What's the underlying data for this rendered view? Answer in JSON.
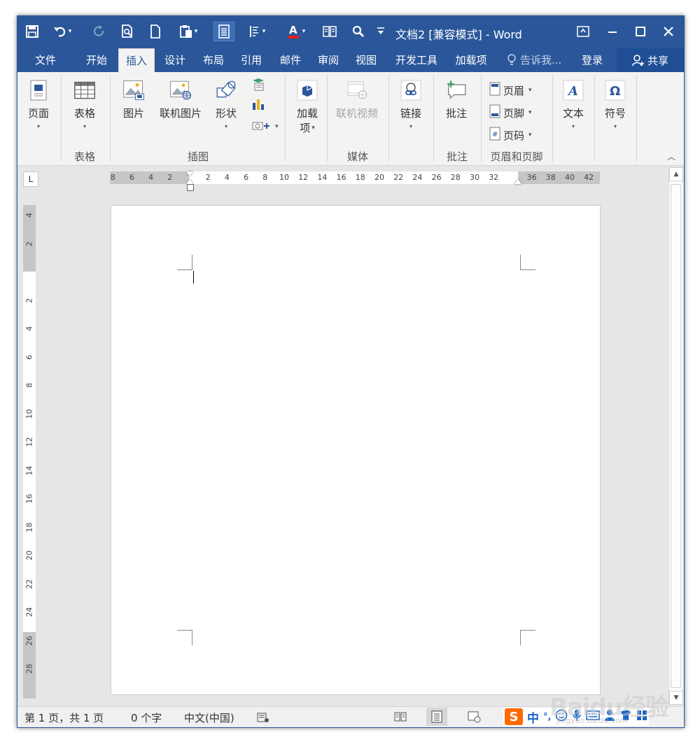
{
  "titlebar": {
    "title": "文档2 [兼容模式] - Word",
    "qat": [
      "save-icon",
      "undo-icon",
      "redo-icon",
      "print-preview-icon",
      "new-document-icon",
      "paste-icon",
      "layout-icon",
      "paragraph-icon",
      "font-color-icon",
      "columns-icon",
      "find-icon",
      "customize-icon"
    ],
    "controls": [
      "ribbon-display-icon",
      "minimize-icon",
      "maximize-icon",
      "close-icon"
    ]
  },
  "tabs": {
    "file": "文件",
    "home": "开始",
    "insert": "插入",
    "design": "设计",
    "layout": "布局",
    "references": "引用",
    "mailings": "邮件",
    "review": "审阅",
    "view": "视图",
    "developer": "开发工具",
    "addins": "加载项",
    "tellme": "告诉我...",
    "login": "登录",
    "share": "共享"
  },
  "ribbon": {
    "pages": "页面",
    "table": "表格",
    "picture": "图片",
    "online_picture": "联机图片",
    "shapes": "形状",
    "addins": "加载",
    "addins_line2": "项",
    "online_video": "联机视频",
    "link": "链接",
    "comment": "批注",
    "header": "页眉",
    "footer": "页脚",
    "page_number": "页码",
    "text": "文本",
    "symbol": "符号",
    "groups": {
      "table": "表格",
      "illustrations": "插图",
      "media": "媒体",
      "comments": "批注",
      "header_footer": "页眉和页脚"
    }
  },
  "ruler": {
    "corner": "L",
    "h_left": [
      "8",
      "6",
      "4",
      "2"
    ],
    "h_right": [
      "2",
      "4",
      "6",
      "8",
      "10",
      "12",
      "14",
      "16",
      "18",
      "20",
      "22",
      "24",
      "26",
      "28",
      "30",
      "32"
    ],
    "h_far": [
      "36",
      "38",
      "40",
      "42"
    ],
    "v_top": [
      "4",
      "2"
    ],
    "v_body": [
      "2",
      "4",
      "6",
      "8",
      "10",
      "12",
      "14",
      "16",
      "18",
      "20",
      "22",
      "24"
    ],
    "v_bottom": [
      "26",
      "28"
    ]
  },
  "status": {
    "page": "第 1 页，共 1 页",
    "words": "0 个字",
    "language": "中文(中国)"
  },
  "ime": {
    "logo": "S",
    "mode": "中",
    "punct": "°,"
  },
  "watermark": {
    "text": "Baidu经验",
    "sub": "jingyan.baidu.com"
  },
  "colors": {
    "brand": "#2b579a",
    "ribbon_bg": "#f3f3f3",
    "ime_orange": "#ff6a00"
  }
}
